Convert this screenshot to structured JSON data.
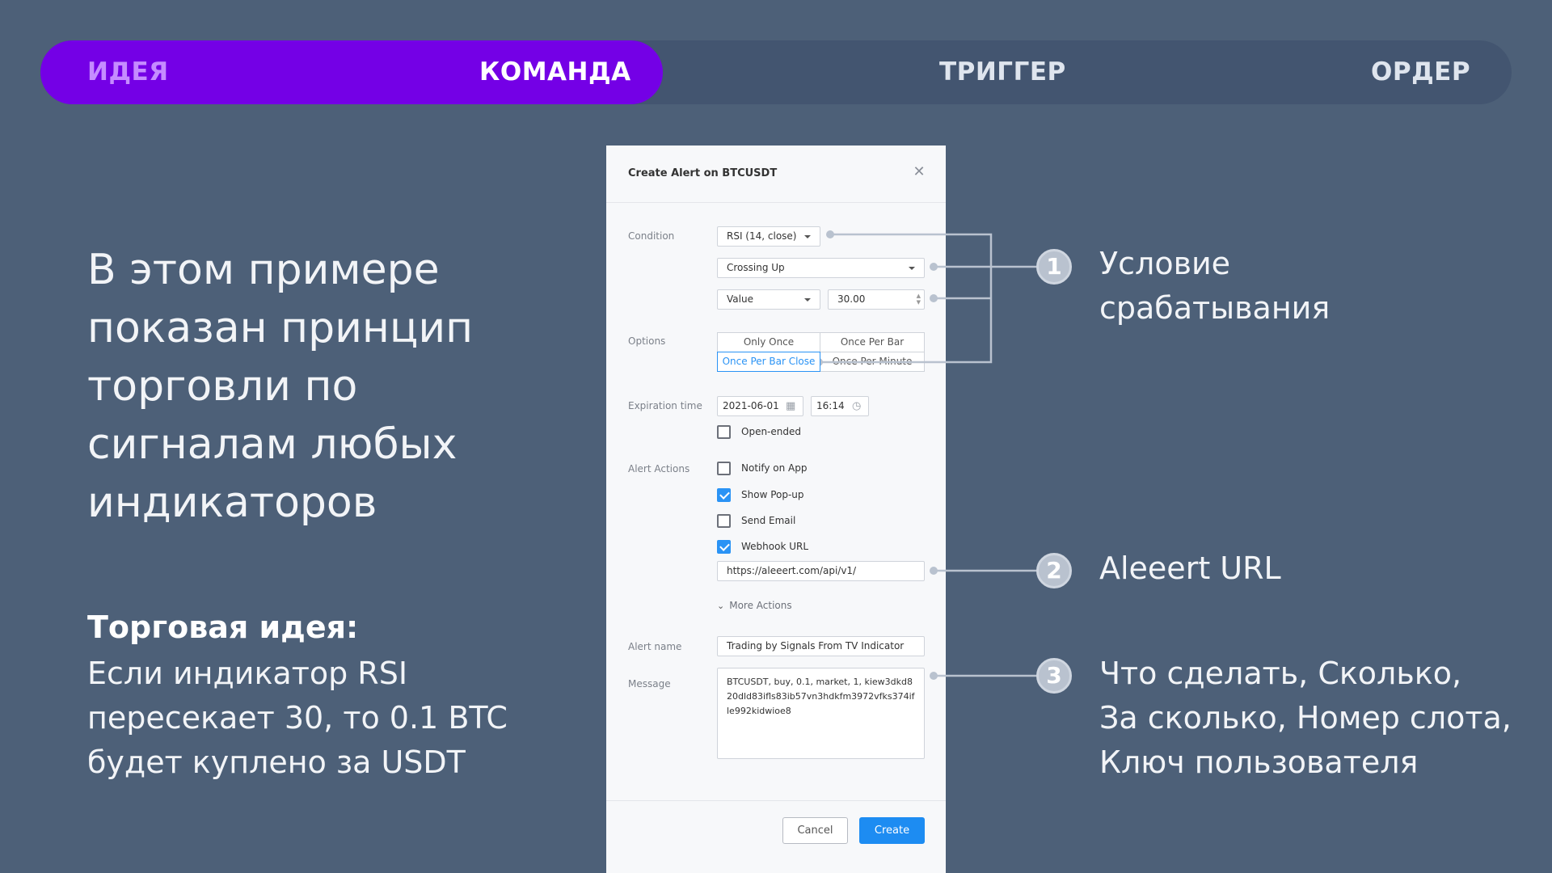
{
  "steps": [
    "ИДЕЯ",
    "КОМАНДА",
    "ТРИГГЕР",
    "ОРДЕР"
  ],
  "colors": {
    "background": "#4d6078",
    "progress_track": "#435570",
    "progress_fill": "#7400e6",
    "accent_blue": "#1d8cf2"
  },
  "left": {
    "headline_lines": [
      "В этом примере",
      "показан принцип",
      "торговли по",
      "сигналам любых",
      "индикаторов"
    ],
    "idea_title": "Торговая идея:",
    "idea_lines": [
      "Если индикатор RSI",
      "пересекает 30, то 0.1 BTC",
      "будет куплено за USDT"
    ]
  },
  "dialog": {
    "title": "Create Alert on BTCUSDT",
    "close_icon": "close-icon",
    "labels": {
      "condition": "Condition",
      "options": "Options",
      "expiration": "Expiration time",
      "alert_actions": "Alert Actions",
      "alert_name": "Alert name",
      "message": "Message"
    },
    "condition": {
      "indicator": "RSI (14, close)",
      "operator": "Crossing Up",
      "value_type": "Value",
      "value": "30.00"
    },
    "options": {
      "only_once": "Only Once",
      "once_per_bar": "Once Per Bar",
      "once_per_bar_close": "Once Per Bar Close",
      "once_per_minute": "Once Per Minute",
      "selected": "Once Per Bar Close"
    },
    "expiration": {
      "date": "2021-06-01",
      "time": "16:14",
      "open_ended_label": "Open-ended",
      "open_ended_checked": false
    },
    "actions": {
      "notify_on_app": {
        "label": "Notify on App",
        "checked": false
      },
      "show_popup": {
        "label": "Show Pop-up",
        "checked": true
      },
      "send_email": {
        "label": "Send Email",
        "checked": false
      },
      "webhook": {
        "label": "Webhook URL",
        "checked": true
      }
    },
    "webhook_url": "https://aleeert.com/api/v1/",
    "more_actions": "More Actions",
    "alert_name": "Trading by Signals From TV Indicator",
    "message": "BTCUSDT, buy, 0.1, market, 1, kiew3dkd820dld83ifls83ib57vn3hdkfm3972vfks374ifle992kidwioe8",
    "cancel_label": "Cancel",
    "create_label": "Create"
  },
  "callouts": [
    {
      "number": "1",
      "lines": [
        "Условие",
        "срабатывания"
      ]
    },
    {
      "number": "2",
      "lines": [
        "Aleeert URL"
      ]
    },
    {
      "number": "3",
      "lines": [
        "Что сделать, Сколько,",
        "За сколько, Номер слота,",
        "Ключ пользователя"
      ]
    }
  ]
}
